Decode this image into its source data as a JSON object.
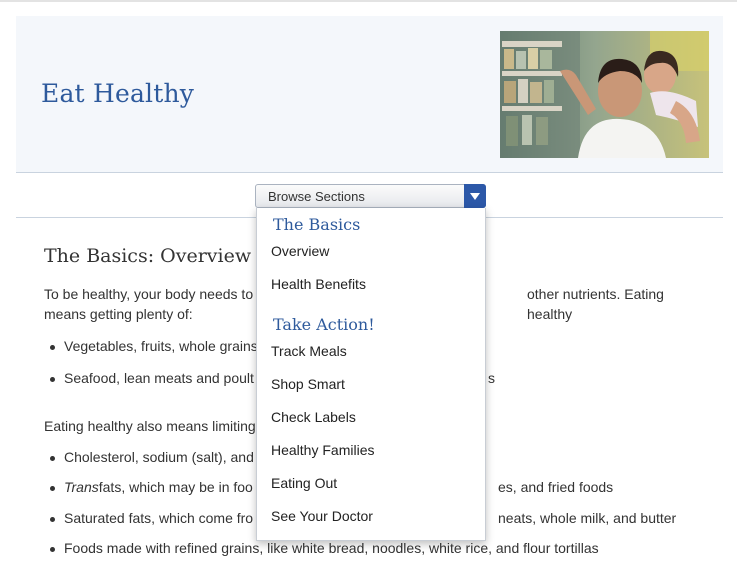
{
  "hero": {
    "title": "Eat Healthy"
  },
  "browse": {
    "label": "Browse Sections",
    "groups": [
      {
        "heading": "The Basics",
        "items": [
          "Overview",
          "Health Benefits"
        ]
      },
      {
        "heading": "Take Action!",
        "items": [
          "Track Meals",
          "Shop Smart",
          "Check Labels",
          "Healthy Families",
          "Eating Out",
          "See Your Doctor"
        ]
      }
    ]
  },
  "article": {
    "heading": "The Basics: Overview",
    "intro_line1": "To be healthy, your body needs to",
    "intro_line1_end": "other nutrients. Eating healthy",
    "intro_line2": "means getting plenty of:",
    "list1": [
      {
        "start": "Vegetables, fruits, whole grains",
        "end": ""
      },
      {
        "start": "Seafood, lean meats and poult",
        "end": "s"
      }
    ],
    "limit_intro": "Eating healthy also means limiting",
    "list2": [
      {
        "start": "Cholesterol, sodium (salt), and",
        "end": ""
      },
      {
        "italic": "Trans",
        "start": " fats, which may be in foo",
        "end": "es, and fried foods"
      },
      {
        "start": "Saturated fats, which come fro",
        "end": "neats, whole milk, and butter"
      },
      {
        "start": "Foods made with refined grains, like white bread, noodles, white rice, and flour tortillas",
        "end": ""
      }
    ]
  }
}
